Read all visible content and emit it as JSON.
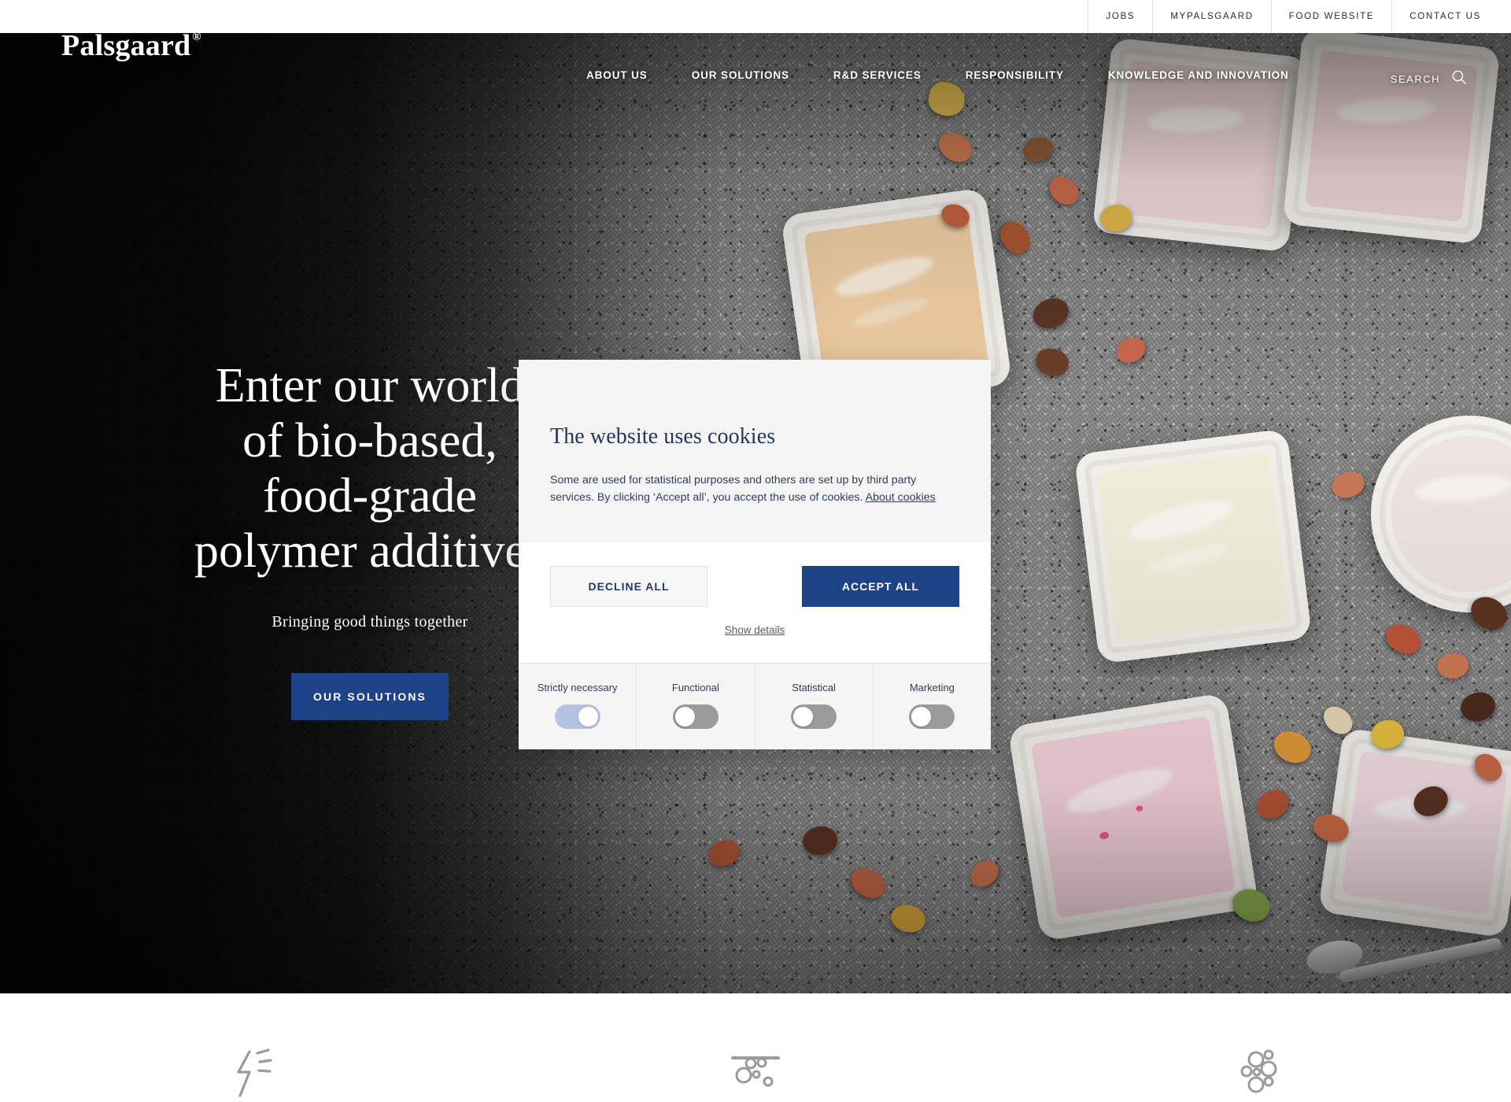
{
  "topbar": {
    "items": [
      {
        "label": "JOBS",
        "name": "topbar-item-jobs"
      },
      {
        "label": "MYPALSGAARD",
        "name": "topbar-item-mypalsgaard"
      },
      {
        "label": "FOOD WEBSITE",
        "name": "topbar-item-food-website"
      },
      {
        "label": "CONTACT US",
        "name": "topbar-item-contact-us"
      }
    ]
  },
  "brand": {
    "name": "Palsgaard",
    "registered_mark": "®"
  },
  "nav": {
    "items": [
      {
        "label": "ABOUT US"
      },
      {
        "label": "OUR SOLUTIONS"
      },
      {
        "label": "R&D SERVICES"
      },
      {
        "label": "RESPONSIBILITY"
      },
      {
        "label": "KNOWLEDGE AND INNOVATION"
      }
    ],
    "search_label": "SEARCH",
    "search_icon": "search-icon"
  },
  "hero": {
    "title_lines": [
      "Enter our world",
      "of bio-based,",
      "food-grade",
      "polymer additives"
    ],
    "subtitle": "Bringing good things together",
    "cta_label": "OUR SOLUTIONS"
  },
  "cookie": {
    "title": "The website uses cookies",
    "body": "Some are used for statistical purposes and others are set up by third party services. By clicking ‘Accept all’, you accept the use of cookies.",
    "about_link": "About cookies",
    "decline_label": "DECLINE ALL",
    "accept_label": "ACCEPT ALL",
    "show_details_label": "Show details",
    "toggles": [
      {
        "label": "Strictly necessary",
        "on": true
      },
      {
        "label": "Functional",
        "on": false
      },
      {
        "label": "Statistical",
        "on": false
      },
      {
        "label": "Marketing",
        "on": false
      }
    ]
  },
  "features": {
    "items": [
      {
        "icon": "energy-bolt-icon"
      },
      {
        "icon": "anti-fog-bubbles-icon"
      },
      {
        "icon": "molecule-cluster-icon"
      }
    ]
  },
  "colors": {
    "brand_blue": "#1e4287",
    "dialog_text_blue": "#2d3d63",
    "panel_gray": "#f5f5f5",
    "toggle_on": "#b3c4e2",
    "toggle_off": "#9b9b9b"
  }
}
